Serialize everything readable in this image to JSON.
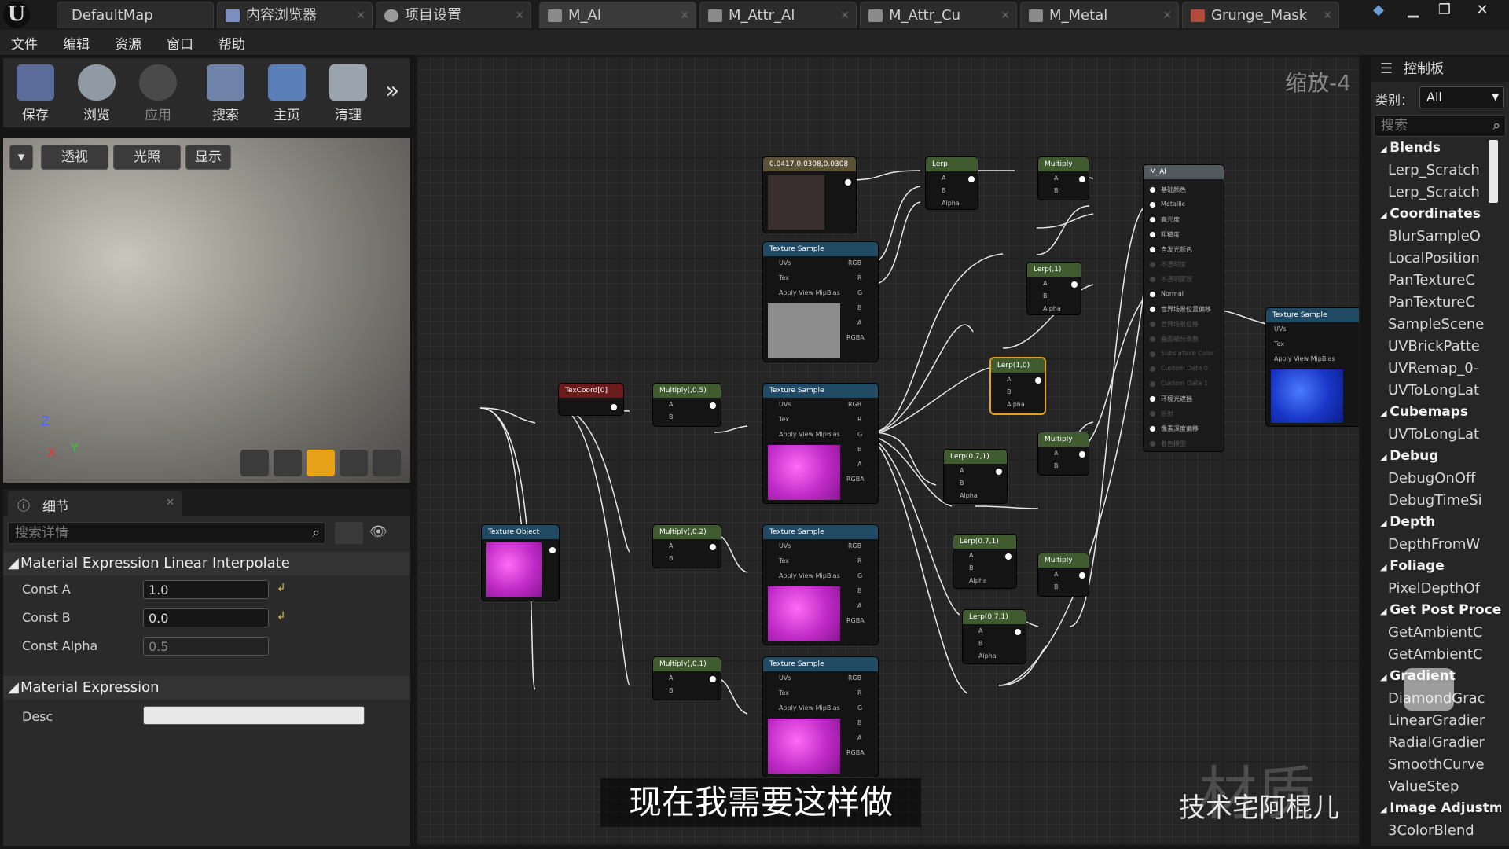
{
  "tabs": [
    {
      "label": "DefaultMap"
    },
    {
      "label": "内容浏览器"
    },
    {
      "label": "项目设置"
    },
    {
      "label": "M_Al"
    },
    {
      "label": "M_Attr_Al"
    },
    {
      "label": "M_Attr_Cu"
    },
    {
      "label": "M_Metal"
    },
    {
      "label": "Grunge_Mask"
    }
  ],
  "menu": [
    "文件",
    "编辑",
    "资源",
    "窗口",
    "帮助"
  ],
  "toolbar": {
    "save": "保存",
    "browse": "浏览",
    "apply": "应用",
    "search": "搜索",
    "home": "主页",
    "clean": "清理"
  },
  "viewport": {
    "perspective": "透视",
    "lighting": "光照",
    "show": "显示",
    "axis_z": "Z",
    "axis_x": "X",
    "axis_y": "Y"
  },
  "details": {
    "tab_label": "细节",
    "search_placeholder": "搜索详情",
    "section1": "Material Expression Linear Interpolate",
    "const_a_label": "Const A",
    "const_a": "1.0",
    "const_b_label": "Const B",
    "const_b": "0.0",
    "const_alpha_label": "Const Alpha",
    "const_alpha": "0.5",
    "section2": "Material Expression",
    "desc_label": "Desc"
  },
  "graph": {
    "zoom": "缩放-4",
    "nodes": {
      "const3": "0.0417,0.0308,0.0308",
      "lerp": "Lerp",
      "multiply": "Multiply",
      "lerp_0_1": "Lerp(,1)",
      "lerp_1_0": "Lerp(1,0)",
      "lerp_07_1": "Lerp(0.7,1)",
      "texcoord": "TexCoord[0]",
      "multiply_05": "Multiply(,0.5)",
      "multiply_02": "Multiply(,0.2)",
      "multiply_01": "Multiply(,0.1)",
      "texture_sample": "Texture Sample",
      "texture_object": "Texture Object",
      "material": "M_Al"
    },
    "pins": {
      "uvs": "UVs",
      "tex": "Tex",
      "mip": "Apply View MipBias",
      "rgb": "RGB",
      "r": "R",
      "g": "G",
      "b": "B",
      "a": "A",
      "rgba": "RGBA",
      "alpha": "Alpha"
    },
    "material_pins": [
      "基础颜色",
      "Metallic",
      "高光度",
      "粗糙度",
      "自发光颜色",
      "不透明度",
      "不透明蒙版",
      "Normal",
      "世界场景位置偏移",
      "世界场景位移",
      "曲面细分乘数",
      "Subsurface Color",
      "Custom Data 0",
      "Custom Data 1",
      "环境光遮挡",
      "折射",
      "像素深度偏移",
      "着色模型"
    ]
  },
  "palette": {
    "title": "控制板",
    "category_label": "类别：",
    "category_value": "All",
    "search_placeholder": "搜索",
    "groups": [
      {
        "name": "Blends",
        "items": [
          "Lerp_Scratch",
          "Lerp_Scratch"
        ]
      },
      {
        "name": "Coordinates",
        "items": [
          "BlurSampleO",
          "LocalPosition",
          "PanTextureC",
          "PanTextureC",
          "SampleScene",
          "UVBrickPatte",
          "UVRemap_0-",
          "UVToLongLat"
        ]
      },
      {
        "name": "Cubemaps",
        "items": [
          "UVToLongLat"
        ]
      },
      {
        "name": "Debug",
        "items": [
          "DebugOnOff",
          "DebugTimeSi"
        ]
      },
      {
        "name": "Depth",
        "items": [
          "DepthFromW"
        ]
      },
      {
        "name": "Foliage",
        "items": [
          "PixelDepthOf"
        ]
      },
      {
        "name": "Get Post Proces",
        "items": [
          "GetAmbientC",
          "GetAmbientC"
        ]
      },
      {
        "name": "Gradient",
        "items": [
          "DiamondGrac",
          "LinearGradier",
          "RadialGradier",
          "SmoothCurve",
          "ValueStep"
        ]
      },
      {
        "name": "Image Adjustm",
        "items": [
          "3ColorBlend"
        ]
      }
    ]
  },
  "subtitle": "现在我需要这样做",
  "watermark": "技术宅阿棍儿",
  "bg_text": "材质",
  "colors": {
    "accent": "#e8a21a",
    "pink": "#d233d6",
    "blue": "#1e3fd0"
  }
}
